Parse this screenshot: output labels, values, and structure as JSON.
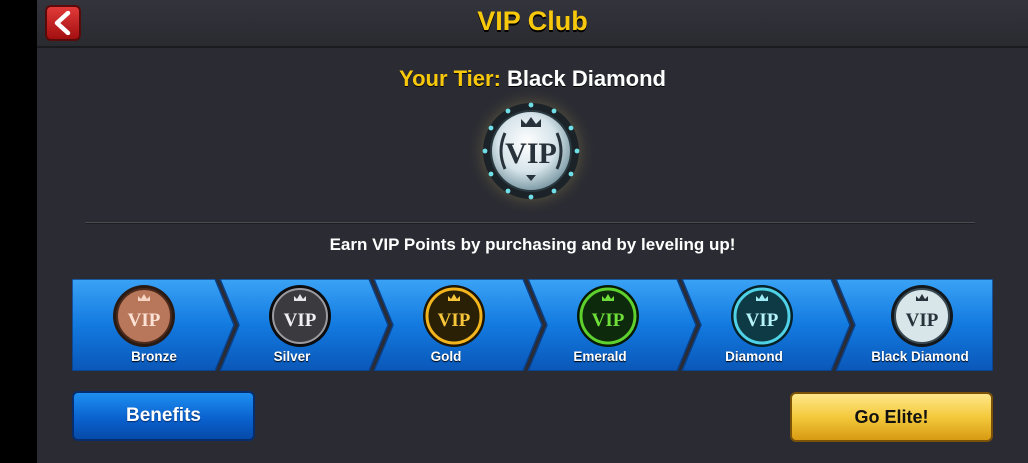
{
  "header": {
    "title": "VIP Club",
    "back_icon": "chevron-left-icon"
  },
  "tier": {
    "label": "Your Tier:",
    "value": "Black Diamond",
    "badge_text": "VIP"
  },
  "info_text": "Earn VIP Points by purchasing and by leveling up!",
  "tiers": [
    {
      "name": "Bronze",
      "badge_text": "VIP",
      "color": "#b8765a"
    },
    {
      "name": "Silver",
      "badge_text": "VIP",
      "color": "#9a9aa0"
    },
    {
      "name": "Gold",
      "badge_text": "VIP",
      "color": "#f2b51e"
    },
    {
      "name": "Emerald",
      "badge_text": "VIP",
      "color": "#5fd12e"
    },
    {
      "name": "Diamond",
      "badge_text": "VIP",
      "color": "#4fd1e6"
    },
    {
      "name": "Black Diamond",
      "badge_text": "VIP",
      "color": "#d8e6ea"
    }
  ],
  "buttons": {
    "benefits": "Benefits",
    "go_elite": "Go Elite!"
  },
  "colors": {
    "accent_yellow": "#f7c80c",
    "panel_blue": "#1a7fe0"
  }
}
